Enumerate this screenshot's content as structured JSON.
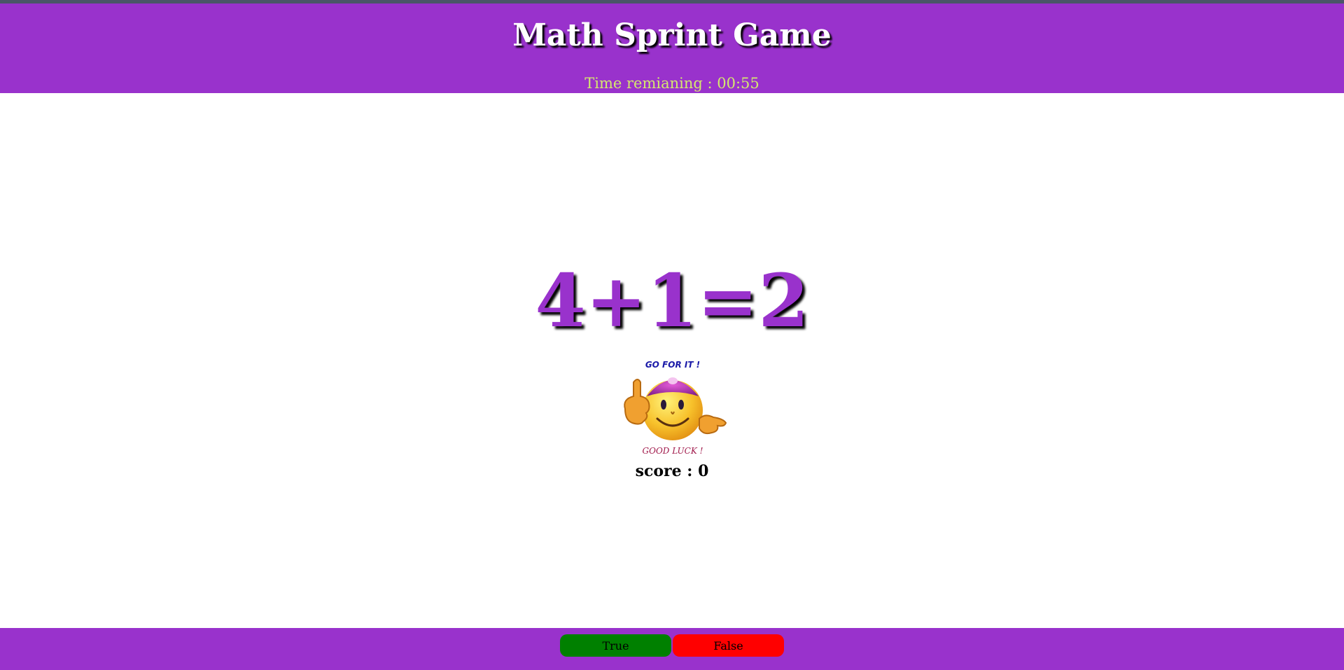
{
  "header": {
    "title": "Math Sprint Game",
    "timer_label": "Time remianing : 00:55"
  },
  "game": {
    "equation": "4+1=2",
    "mascot": {
      "top_text": "GO FOR IT !",
      "bottom_text": "GOOD LUCK !"
    },
    "score_label": "score : 0"
  },
  "footer": {
    "true_label": "True",
    "false_label": "False"
  },
  "colors": {
    "brand": "#9932cc",
    "timer_text": "#d4e86e",
    "true_button": "#008000",
    "false_button": "#ff0000"
  }
}
